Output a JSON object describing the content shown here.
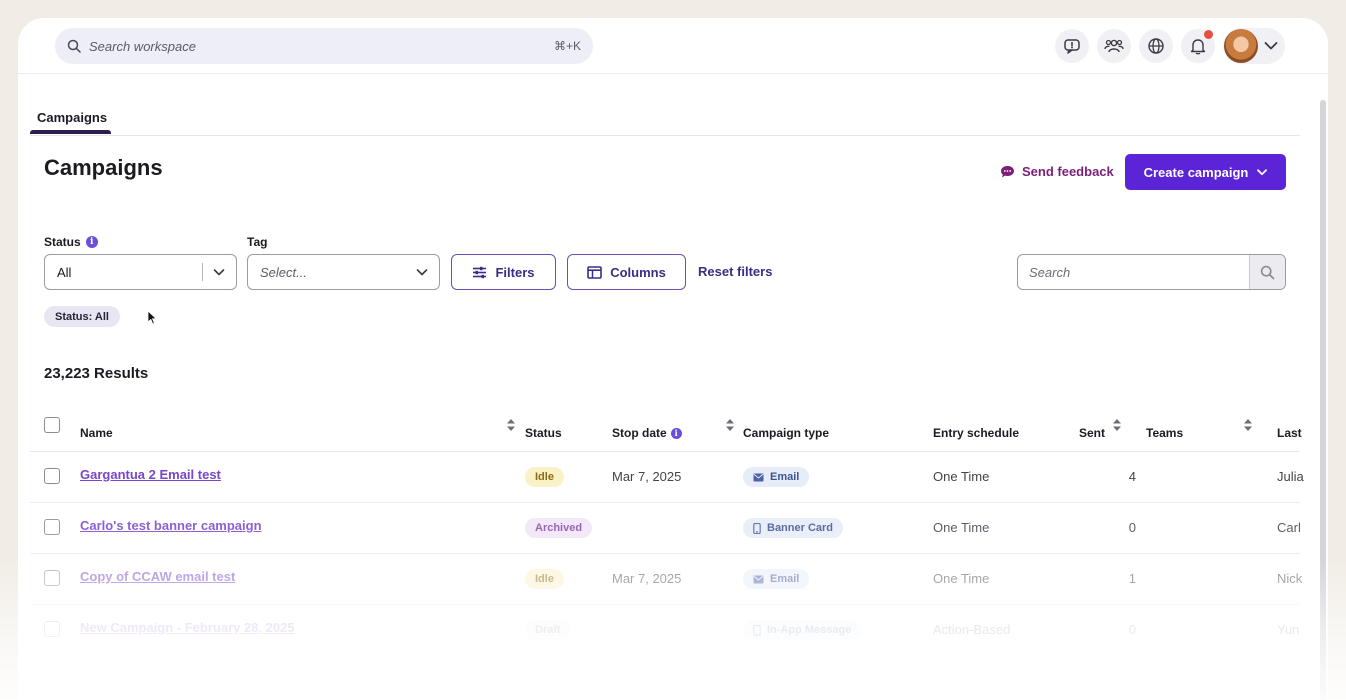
{
  "topbar": {
    "search_placeholder": "Search workspace",
    "search_shortcut": "⌘+K",
    "icons": [
      "feedback-alert-icon",
      "users-icon",
      "globe-icon",
      "bell-icon"
    ]
  },
  "tabs": [
    {
      "label": "Campaigns",
      "active": true
    }
  ],
  "page": {
    "title": "Campaigns",
    "send_feedback": "Send feedback",
    "create_campaign": "Create campaign"
  },
  "filters": {
    "status_label": "Status",
    "status_value": "All",
    "tag_label": "Tag",
    "tag_placeholder": "Select...",
    "filters_button": "Filters",
    "columns_button": "Columns",
    "reset_filters": "Reset filters",
    "search_placeholder": "Search",
    "active_chip": "Status: All"
  },
  "results_count": "23,223 Results",
  "table": {
    "columns": {
      "name": "Name",
      "status": "Status",
      "stop_date": "Stop date",
      "campaign_type": "Campaign type",
      "entry_schedule": "Entry schedule",
      "sent": "Sent",
      "teams": "Teams",
      "last": "Last"
    },
    "rows": [
      {
        "name": "Gargantua 2 Email test",
        "status": "Idle",
        "stop_date": "Mar 7, 2025",
        "type": "Email",
        "schedule": "One Time",
        "sent": "4",
        "last": "Julia"
      },
      {
        "name": "Carlo's test banner campaign",
        "status": "Archived",
        "stop_date": "",
        "type": "Banner Card",
        "schedule": "One Time",
        "sent": "0",
        "last": "Carl"
      },
      {
        "name": "Copy of CCAW email test",
        "status": "Idle",
        "stop_date": "Mar 7, 2025",
        "type": "Email",
        "schedule": "One Time",
        "sent": "1",
        "last": "Nick"
      },
      {
        "name": "New Campaign - February 28, 2025",
        "status": "Draft",
        "stop_date": "",
        "type": "In-App Message",
        "schedule": "Action-Based",
        "sent": "0",
        "last": "Yun"
      }
    ]
  },
  "colors": {
    "primary": "#5b24d6",
    "link": "#7a45c9",
    "feedback": "#7b1f79",
    "notification_dot": "#e4513c"
  }
}
